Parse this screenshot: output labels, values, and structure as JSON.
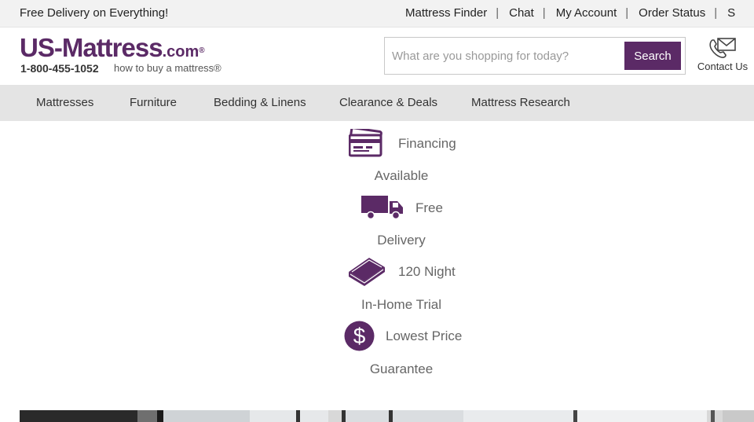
{
  "topbar": {
    "promo": "Free Delivery on Everything!",
    "links": [
      "Mattress Finder",
      "Chat",
      "My Account",
      "Order Status",
      "S"
    ],
    "separator": "|"
  },
  "header": {
    "logo": {
      "brand": "US-Mattress",
      "tld": ".com",
      "registered": "®",
      "phone": "1-800-455-1052",
      "tagline": "how to buy a mattress®"
    },
    "search": {
      "placeholder": "What are you shopping for today?",
      "value": "",
      "button_label": "Search"
    },
    "contact_label": "Contact Us"
  },
  "nav": {
    "items": [
      "Mattresses",
      "Furniture",
      "Bedding & Linens",
      "Clearance & Deals",
      "Mattress Research"
    ]
  },
  "features": [
    {
      "icon": "credit-card-icon",
      "line1": "Financing",
      "line2": "Available"
    },
    {
      "icon": "delivery-truck-icon",
      "line1": "Free",
      "line2": "Delivery"
    },
    {
      "icon": "mattress-icon",
      "line1": "120 Night",
      "line2": "In-Home Trial"
    },
    {
      "icon": "dollar-coin-icon",
      "line1": "Lowest Price",
      "line2": "Guarantee"
    }
  ],
  "colors": {
    "brand": "#5b2a66",
    "topbar_bg": "#f2f2f2",
    "nav_bg": "#e4e4e4",
    "feature_text": "#666666"
  }
}
